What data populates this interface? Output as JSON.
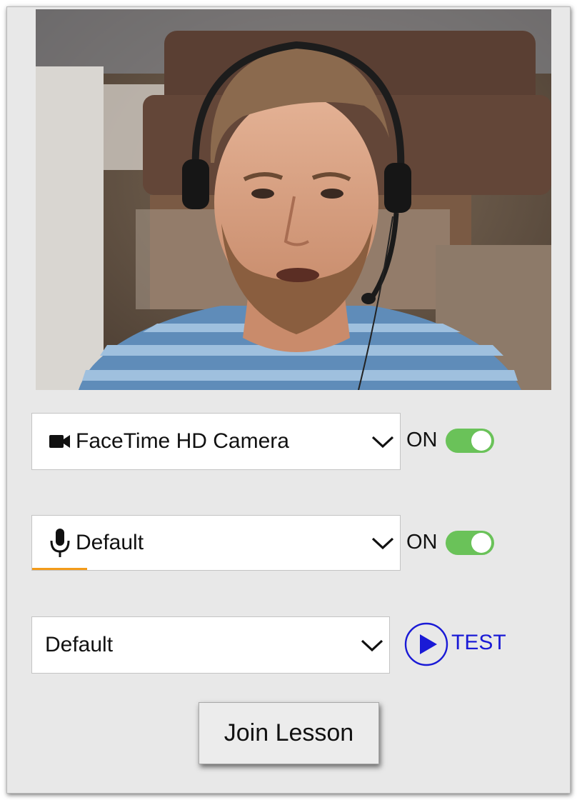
{
  "video": {
    "icon": "webcam-preview-image"
  },
  "camera": {
    "icon": "video-camera-icon",
    "selected": "FaceTime HD Camera",
    "state_label": "ON",
    "enabled": true
  },
  "microphone": {
    "icon": "microphone-icon",
    "selected": "Default",
    "state_label": "ON",
    "enabled": true,
    "input_level": 0.15
  },
  "speaker": {
    "selected": "Default",
    "test_label": "TEST",
    "test_icon": "play-icon"
  },
  "actions": {
    "join_label": "Join Lesson"
  },
  "colors": {
    "toggle_on": "#6ac259",
    "accent_blue": "#1a1ad6",
    "level_orange": "#f39b1a"
  }
}
